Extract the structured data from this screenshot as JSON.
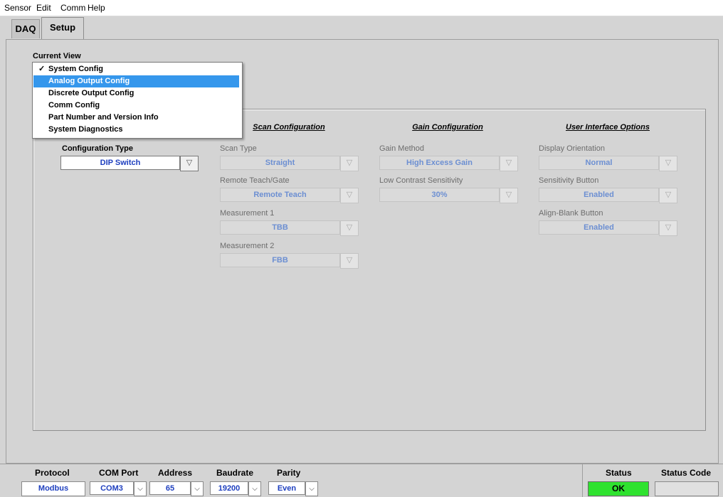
{
  "menu": [
    "Sensor",
    "Edit",
    "Comm",
    "Help"
  ],
  "tabs": [
    {
      "label": "DAQ",
      "active": false
    },
    {
      "label": "Setup",
      "active": true
    }
  ],
  "current_view": {
    "label": "Current View",
    "options": [
      {
        "label": "System Config",
        "checked": true,
        "highlighted": false
      },
      {
        "label": "Analog Output Config",
        "checked": false,
        "highlighted": true
      },
      {
        "label": "Discrete Output Config",
        "checked": false,
        "highlighted": false
      },
      {
        "label": "Comm Config",
        "checked": false,
        "highlighted": false
      },
      {
        "label": "Part Number and Version Info",
        "checked": false,
        "highlighted": false
      },
      {
        "label": "System Diagnostics",
        "checked": false,
        "highlighted": false
      }
    ],
    "check_glyph": "✓"
  },
  "config_type": {
    "label": "Configuration Type",
    "value": "DIP Switch"
  },
  "scan": {
    "heading": "Scan Configuration",
    "scan_type": {
      "label": "Scan Type",
      "value": "Straight"
    },
    "remote": {
      "label": "Remote Teach/Gate",
      "value": "Remote Teach"
    },
    "meas1": {
      "label": "Measurement 1",
      "value": "TBB"
    },
    "meas2": {
      "label": "Measurement 2",
      "value": "FBB"
    }
  },
  "gain": {
    "heading": "Gain Configuration",
    "method": {
      "label": "Gain Method",
      "value": "High Excess Gain"
    },
    "contrast": {
      "label": "Low Contrast Sensitivity",
      "value": "30%"
    }
  },
  "ui_options": {
    "heading": "User Interface Options",
    "orientation": {
      "label": "Display Orientation",
      "value": "Normal"
    },
    "sensitivity": {
      "label": "Sensitivity Button",
      "value": "Enabled"
    },
    "align": {
      "label": "Align-Blank Button",
      "value": "Enabled"
    }
  },
  "footer": {
    "protocol": {
      "label": "Protocol",
      "value": "Modbus"
    },
    "com_port": {
      "label": "COM Port",
      "value": "COM3"
    },
    "address": {
      "label": "Address",
      "value": "65"
    },
    "baudrate": {
      "label": "Baudrate",
      "value": "19200"
    },
    "parity": {
      "label": "Parity",
      "value": "Even"
    },
    "status": {
      "label": "Status",
      "value": "OK"
    },
    "status_code": {
      "label": "Status Code",
      "value": ""
    }
  },
  "icons": {
    "dropdown_arrow": "▽",
    "chevron_down": "⌵"
  },
  "colors": {
    "status_ok": "#2fe22f",
    "highlight": "#3597ec",
    "value_text": "#1e3fbf"
  }
}
